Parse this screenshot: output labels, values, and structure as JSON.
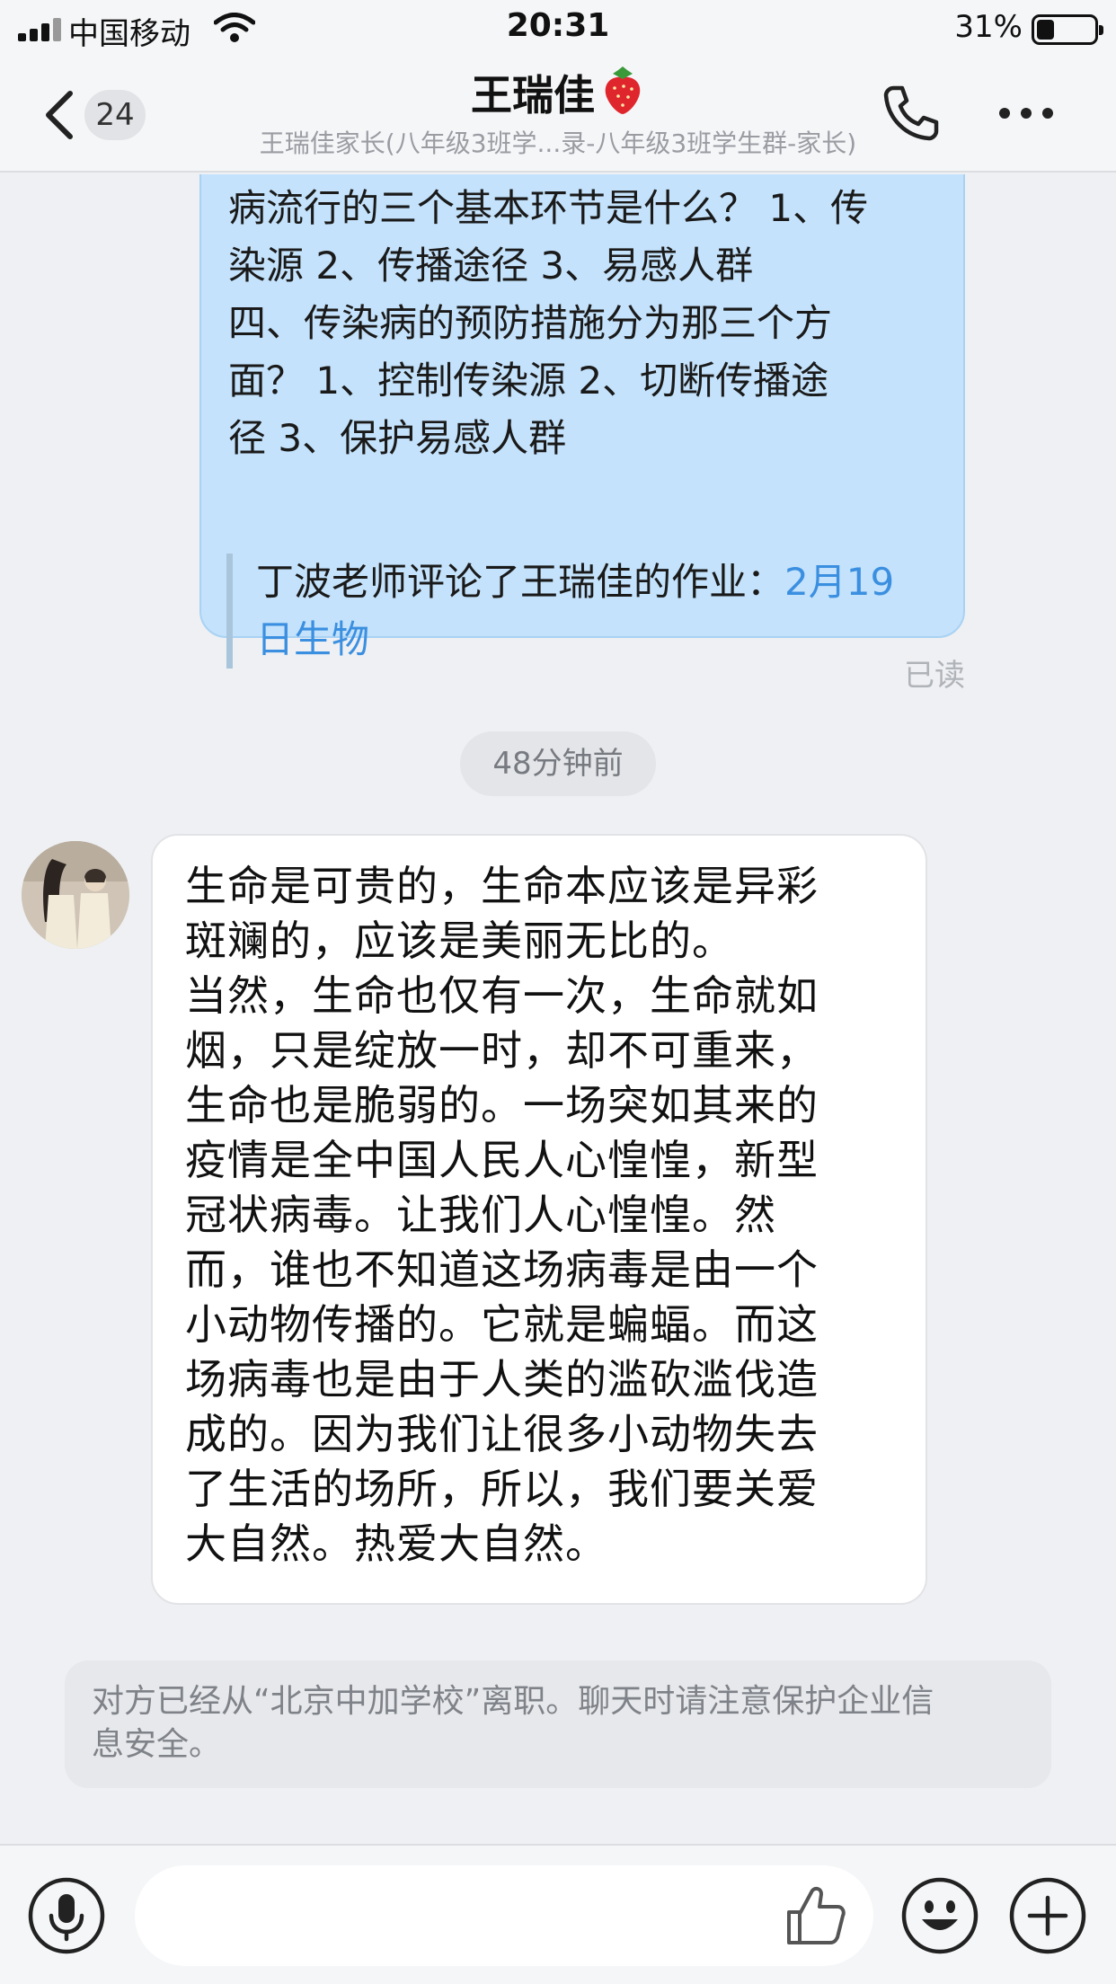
{
  "status_bar": {
    "carrier": "中国移动",
    "time": "20:31",
    "battery_percent": "31%",
    "battery_level": 0.31
  },
  "header": {
    "unread_count": "24",
    "title": "王瑞佳",
    "title_emoji_icon": "strawberry-icon",
    "subtitle": "王瑞佳家长(八年级3班学...录-八年级3班学生群-家长)"
  },
  "messages": {
    "sent": {
      "lines": [
        "病流行的三个基本环节是什么？ 1、传",
        "染源    2、传播途径    3、易感人群",
        "四、传染病的预防措施分为那三个方",
        "面？ 1、控制传染源    2、切断传播途",
        "径    3、保护易感人群"
      ],
      "quote_prefix": "丁波老师评论了王瑞佳的作业：",
      "quote_link_part1": "2月19",
      "quote_link_part2": "日生物",
      "read_status": "已读"
    },
    "time_divider": "48分钟前",
    "received": {
      "lines": [
        "生命是可贵的，生命本应该是异彩",
        "斑斓的，应该是美丽无比的。",
        "当然，生命也仅有一次，生命就如",
        "烟，只是绽放一时，却不可重来，",
        "生命也是脆弱的。一场突如其来的",
        "疫情是全中国人民人心惶惶，新型",
        "冠状病毒。让我们人心惶惶。然",
        "而，谁也不知道这场病毒是由一个",
        "小动物传播的。它就是蝙蝠。而这",
        "场病毒也是由于人类的滥砍滥伐造",
        "成的。因为我们让很多小动物失去",
        "了生活的场所，所以，我们要关爱",
        "大自然。热爱大自然。"
      ]
    },
    "notice_lines": [
      "对方已经从“北京中加学校”离职。聊天时请注意保护企业信",
      "息安全。"
    ]
  },
  "input_bar": {
    "placeholder": ""
  },
  "colors": {
    "sent_bubble": "#c4e2fb",
    "link": "#3b8fe0",
    "background": "#eef0f3"
  }
}
